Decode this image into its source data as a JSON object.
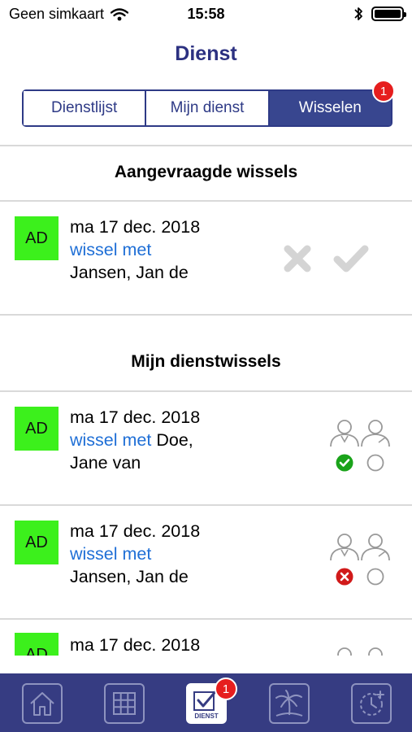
{
  "status_bar": {
    "carrier": "Geen simkaart",
    "time": "15:58"
  },
  "header": {
    "title": "Dienst"
  },
  "segments": [
    {
      "label": "Dienstlijst",
      "active": false
    },
    {
      "label": "Mijn dienst",
      "active": false
    },
    {
      "label": "Wisselen",
      "active": true,
      "badge": "1"
    }
  ],
  "requested_section": {
    "title": "Aangevraagde wissels",
    "items": [
      {
        "initials": "AD",
        "date": "ma 17 dec. 2018",
        "link": "wissel met",
        "name": "Jansen, Jan de"
      }
    ]
  },
  "my_section": {
    "title": "Mijn dienstwissels",
    "items": [
      {
        "initials": "AD",
        "date": "ma 17 dec. 2018",
        "link": "wissel met",
        "name_inline": "Doe,",
        "name_line2": "Jane van",
        "status": "approved"
      },
      {
        "initials": "AD",
        "date": "ma 17 dec. 2018",
        "link": "wissel met",
        "name_line2": "Jansen, Jan de",
        "status": "rejected"
      },
      {
        "initials": "AD",
        "date": "ma 17 dec. 2018"
      }
    ]
  },
  "tabbar": {
    "items": [
      {
        "icon": "home-icon"
      },
      {
        "icon": "grid-icon"
      },
      {
        "icon": "dienst-check-icon",
        "label": "DIENST",
        "active": true,
        "badge": "1"
      },
      {
        "icon": "palm-tree-icon"
      },
      {
        "icon": "clock-add-icon"
      }
    ]
  },
  "colors": {
    "accent": "#2e3a86",
    "tabbar": "#363c82",
    "link": "#1f6fd6",
    "avatar": "#3cf01c",
    "badge": "#e61e1e",
    "approved": "#1aa31a",
    "rejected": "#d11a1a"
  }
}
